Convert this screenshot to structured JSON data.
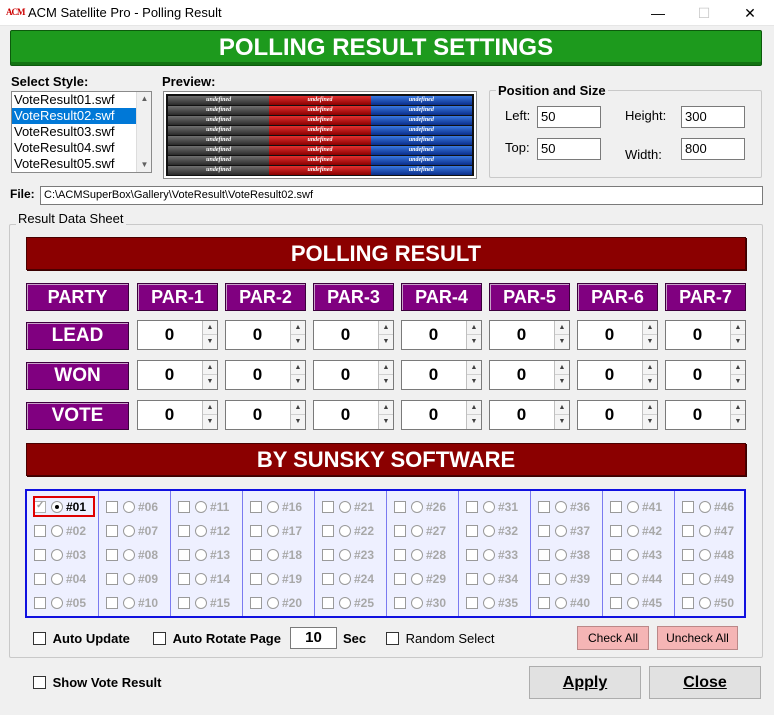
{
  "window": {
    "title": "ACM Satellite Pro - Polling Result",
    "icon_text": "ACM",
    "minimize": "—",
    "maximize": "☐",
    "close": "✕"
  },
  "header": "POLLING RESULT SETTINGS",
  "select_style": {
    "label": "Select Style:",
    "items": [
      "VoteResult01.swf",
      "VoteResult02.swf",
      "VoteResult03.swf",
      "VoteResult04.swf",
      "VoteResult05.swf"
    ],
    "selected_index": 1
  },
  "preview": {
    "label": "Preview:",
    "cell_text": "undefined"
  },
  "position": {
    "title": "Position and Size",
    "left_label": "Left:",
    "left_value": "50",
    "top_label": "Top:",
    "top_value": "50",
    "height_label": "Height:",
    "height_value": "300",
    "width_label": "Width:",
    "width_value": "800"
  },
  "file": {
    "label": "File:",
    "path": "C:\\ACMSuperBox\\Gallery\\VoteResult\\VoteResult02.swf"
  },
  "sheet": {
    "title": "Result Data Sheet",
    "banner_top": "POLLING RESULT",
    "banner_bottom": "BY SUNSKY SOFTWARE",
    "party_label": "PARTY",
    "parties": [
      "PAR-1",
      "PAR-2",
      "PAR-3",
      "PAR-4",
      "PAR-5",
      "PAR-6",
      "PAR-7"
    ],
    "rows": [
      {
        "label": "LEAD",
        "values": [
          "0",
          "0",
          "0",
          "0",
          "0",
          "0",
          "0"
        ]
      },
      {
        "label": "WON",
        "values": [
          "0",
          "0",
          "0",
          "0",
          "0",
          "0",
          "0"
        ]
      },
      {
        "label": "VOTE",
        "values": [
          "0",
          "0",
          "0",
          "0",
          "0",
          "0",
          "0"
        ]
      }
    ],
    "spin_up": "▲",
    "spin_down": "▼"
  },
  "grid": {
    "columns": [
      [
        "#01",
        "#02",
        "#03",
        "#04",
        "#05"
      ],
      [
        "#06",
        "#07",
        "#08",
        "#09",
        "#10"
      ],
      [
        "#11",
        "#12",
        "#13",
        "#14",
        "#15"
      ],
      [
        "#16",
        "#17",
        "#18",
        "#19",
        "#20"
      ],
      [
        "#21",
        "#22",
        "#23",
        "#24",
        "#25"
      ],
      [
        "#26",
        "#27",
        "#28",
        "#29",
        "#30"
      ],
      [
        "#31",
        "#32",
        "#33",
        "#34",
        "#35"
      ],
      [
        "#36",
        "#37",
        "#38",
        "#39",
        "#40"
      ],
      [
        "#41",
        "#42",
        "#43",
        "#44",
        "#45"
      ],
      [
        "#46",
        "#47",
        "#48",
        "#49",
        "#50"
      ]
    ],
    "active": "#01"
  },
  "options": {
    "auto_update": "Auto Update",
    "auto_rotate": "Auto Rotate Page",
    "rotate_seconds": "10",
    "sec_label": "Sec",
    "random_select": "Random Select",
    "check_all": "Check All",
    "uncheck_all": "Uncheck All"
  },
  "footer": {
    "show_vote_result": "Show Vote Result",
    "apply": "Apply",
    "close": "Close"
  },
  "colors": {
    "header_green": "#1d9a1d",
    "banner_red": "#8b0000",
    "party_purple": "#800080",
    "grid_border": "#1010e0"
  }
}
